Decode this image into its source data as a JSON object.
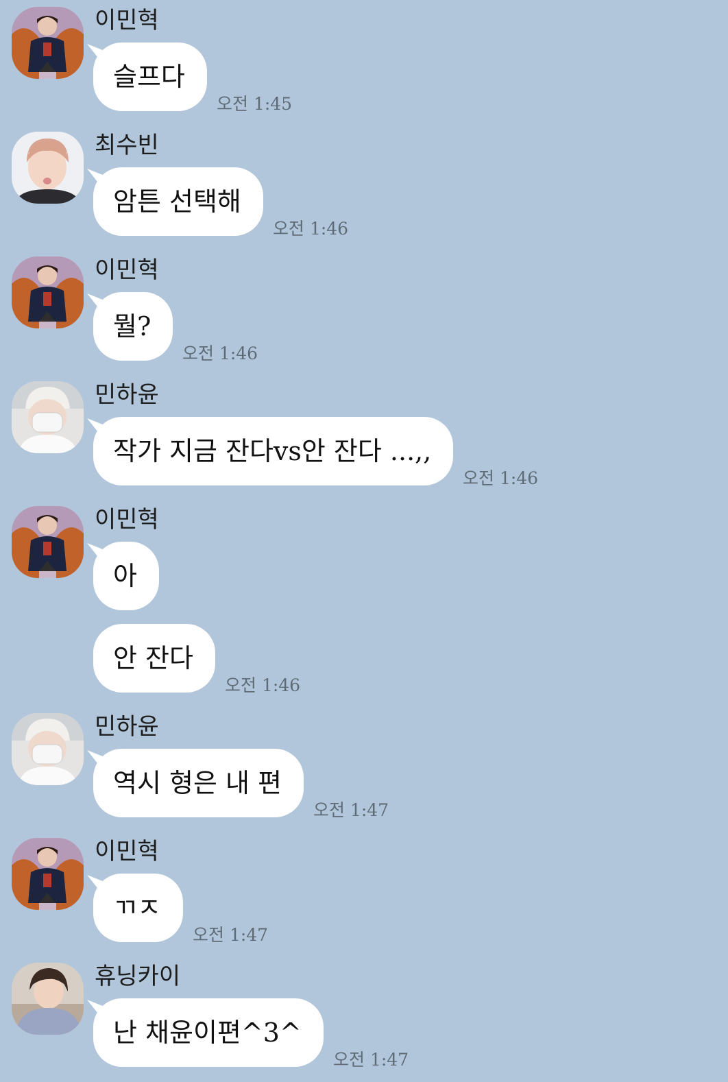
{
  "background_color": "#b1c6da",
  "bubble_color": "#ffffff",
  "messages": [
    {
      "sender": "이민혁",
      "avatar_icon": "avatar-icon-minhyuk",
      "text": "슬프다",
      "time": "오전 1:45"
    },
    {
      "sender": "최수빈",
      "avatar_icon": "avatar-icon-soobin",
      "text": "암튼 선택해",
      "time": "오전 1:46"
    },
    {
      "sender": "이민혁",
      "avatar_icon": "avatar-icon-minhyuk",
      "text": "뭘?",
      "time": "오전 1:46"
    },
    {
      "sender": "민하윤",
      "avatar_icon": "avatar-icon-hayun",
      "text": "작가 지금 잔다vs안 잔다 ...,,",
      "time": "오전 1:46"
    },
    {
      "sender": "이민혁",
      "avatar_icon": "avatar-icon-minhyuk",
      "text": "아",
      "time": ""
    },
    {
      "text": "안 잔다",
      "time": "오전 1:46"
    },
    {
      "sender": "민하윤",
      "avatar_icon": "avatar-icon-hayun",
      "text": "역시 형은 내 편",
      "time": "오전 1:47"
    },
    {
      "sender": "이민혁",
      "avatar_icon": "avatar-icon-minhyuk",
      "text": "ㄲㅈ",
      "time": "오전 1:47"
    },
    {
      "sender": "휴닝카이",
      "avatar_icon": "avatar-icon-hueningkai",
      "text": "난 채윤이편^3^",
      "time": "오전 1:47"
    }
  ]
}
